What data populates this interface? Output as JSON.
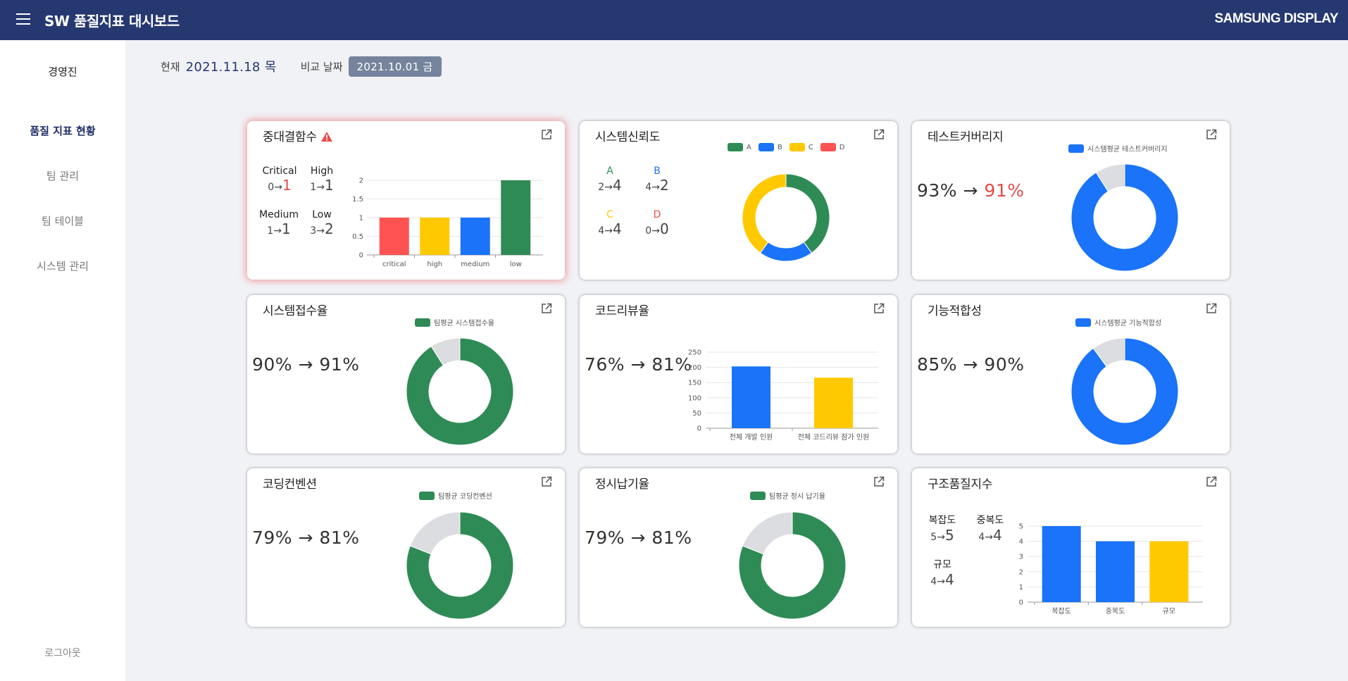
{
  "app": {
    "title": "SW 품질지표 대시보드",
    "brand": "SAMSUNG DISPLAY"
  },
  "sidebar": {
    "user": "경영진",
    "items": [
      {
        "label": "품질 지표 현황",
        "active": true
      },
      {
        "label": "팀 관리"
      },
      {
        "label": "팀 테이블"
      },
      {
        "label": "시스템 관리"
      }
    ],
    "logout": "로그아웃"
  },
  "dates": {
    "current_label": "현재",
    "current": "2021.11.18 목",
    "compare_label": "비교 날짜",
    "compare": "2021.10.01 금"
  },
  "colors": {
    "red": "#ff5252",
    "yellow": "#ffc900",
    "blue": "#1a73f8",
    "green": "#2f8b55",
    "gray": "#dcdde0",
    "header": "#263870"
  },
  "cards": {
    "critical": {
      "title": "중대결함수",
      "stats": [
        {
          "label": "Critical",
          "from": "0",
          "to": "1"
        },
        {
          "label": "High",
          "from": "1",
          "to": "1"
        },
        {
          "label": "Medium",
          "from": "1",
          "to": "1"
        },
        {
          "label": "Low",
          "from": "3",
          "to": "2"
        }
      ]
    },
    "reliability": {
      "title": "시스템신뢰도",
      "legend": [
        "A",
        "B",
        "C",
        "D"
      ],
      "stats": [
        {
          "label": "A",
          "from": "2",
          "to": "4"
        },
        {
          "label": "B",
          "from": "4",
          "to": "2"
        },
        {
          "label": "C",
          "from": "4",
          "to": "4"
        },
        {
          "label": "D",
          "from": "0",
          "to": "0"
        }
      ]
    },
    "coverage": {
      "title": "테스트커버리지",
      "from": "93%",
      "to": "91%",
      "legend": "시스템평균 테스트커버리지"
    },
    "acceptance": {
      "title": "시스템접수율",
      "from": "90%",
      "to": "91%",
      "legend": "팀평균 시스템접수율"
    },
    "review": {
      "title": "코드리뷰율",
      "from": "76%",
      "to": "81%"
    },
    "functional": {
      "title": "기능적합성",
      "from": "85%",
      "to": "90%",
      "legend": "시스템평균 기능적합성"
    },
    "convention": {
      "title": "코딩컨벤션",
      "from": "79%",
      "to": "81%",
      "legend": "팀평균 코딩컨벤션"
    },
    "delivery": {
      "title": "정시납기율",
      "from": "79%",
      "to": "81%",
      "legend": "팀평균 정시 납기율"
    },
    "structure": {
      "title": "구조품질지수",
      "stats": [
        {
          "label": "복잡도",
          "from": "5",
          "to": "5"
        },
        {
          "label": "중복도",
          "from": "4",
          "to": "4"
        },
        {
          "label": "규모",
          "from": "4",
          "to": "4"
        }
      ]
    }
  },
  "chart_data": [
    {
      "type": "bar",
      "id": "critical",
      "categories": [
        "critical",
        "high",
        "medium",
        "low"
      ],
      "values": [
        1,
        1,
        1,
        2
      ],
      "yticks": [
        "0",
        "0.5",
        "1",
        "1.5",
        "2"
      ],
      "ylim": [
        0,
        2
      ],
      "grid": true
    },
    {
      "type": "pie",
      "id": "reliability",
      "donut": true,
      "categories": [
        "A",
        "B",
        "C",
        "D"
      ],
      "values": [
        4,
        2,
        4,
        0
      ]
    },
    {
      "type": "pie",
      "id": "coverage",
      "donut": true,
      "values": [
        91,
        9
      ]
    },
    {
      "type": "pie",
      "id": "acceptance",
      "donut": true,
      "values": [
        91,
        9
      ]
    },
    {
      "type": "bar",
      "id": "review",
      "categories": [
        "전체 개발 인원",
        "전체 코드리뷰 참가 인원"
      ],
      "values": [
        203,
        166
      ],
      "yticks": [
        "0",
        "50",
        "100",
        "150",
        "200",
        "250"
      ],
      "ylim": [
        0,
        250
      ],
      "grid": true
    },
    {
      "type": "pie",
      "id": "functional",
      "donut": true,
      "values": [
        90,
        10
      ]
    },
    {
      "type": "pie",
      "id": "convention",
      "donut": true,
      "values": [
        81,
        19
      ]
    },
    {
      "type": "pie",
      "id": "delivery",
      "donut": true,
      "values": [
        81,
        19
      ]
    },
    {
      "type": "bar",
      "id": "structure",
      "categories": [
        "복잡도",
        "중복도",
        "규모"
      ],
      "values": [
        5,
        4,
        4
      ],
      "yticks": [
        "0",
        "1",
        "2",
        "3",
        "4",
        "5"
      ],
      "ylim": [
        0,
        5
      ],
      "grid": true
    }
  ]
}
